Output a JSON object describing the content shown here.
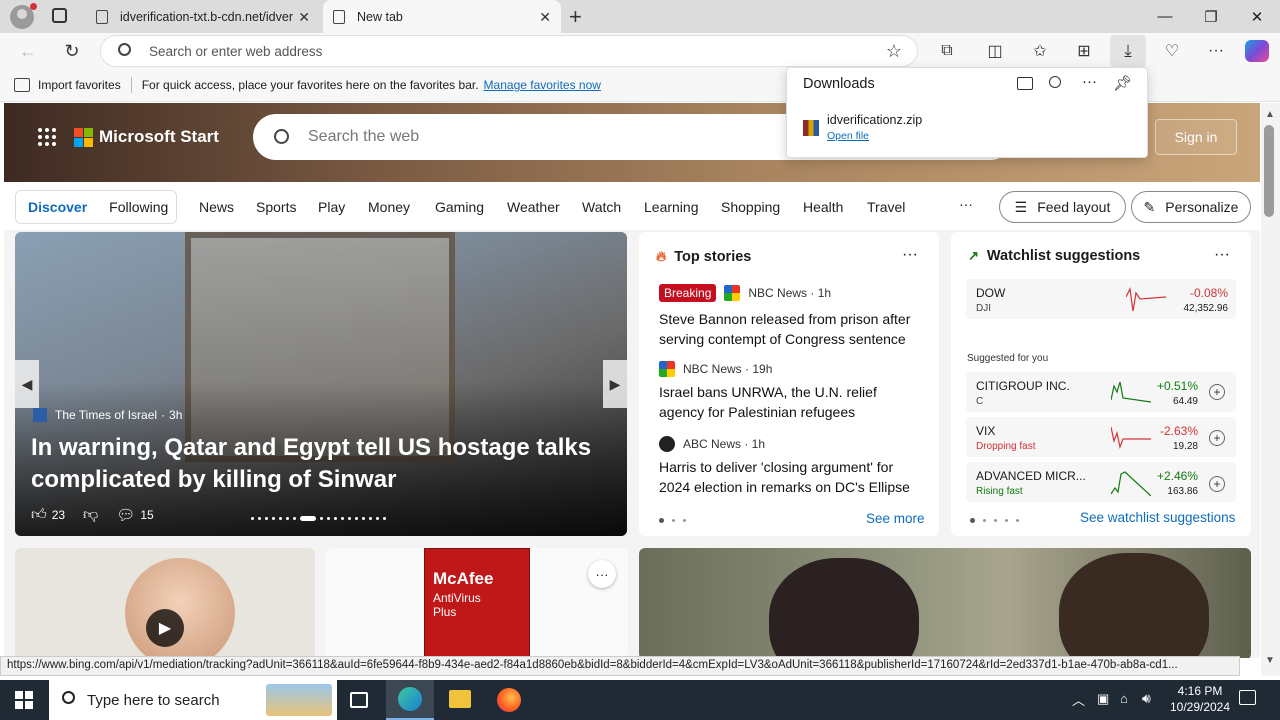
{
  "tabs": [
    {
      "label": "idverification-txt.b-cdn.net/idver"
    },
    {
      "label": "New tab"
    }
  ],
  "address_bar": {
    "placeholder": "Search or enter web address"
  },
  "favorites_bar": {
    "import_label": "Import favorites",
    "message": "For quick access, place your favorites here on the favorites bar.",
    "link": "Manage favorites now"
  },
  "downloads": {
    "title": "Downloads",
    "file_name": "idverificationz.zip",
    "open_label": "Open file"
  },
  "header": {
    "brand": "Microsoft Start",
    "search_placeholder": "Search the web",
    "sign_in": "Sign in"
  },
  "nav": {
    "discover": "Discover",
    "following": "Following",
    "items": [
      "News",
      "Sports",
      "Play",
      "Money",
      "Gaming",
      "Weather",
      "Watch",
      "Learning",
      "Shopping",
      "Health",
      "Travel"
    ],
    "more": "···",
    "feed_layout": "Feed layout",
    "personalize": "Personalize"
  },
  "hero_story": {
    "source": "The Times of Israel",
    "age": "3h",
    "title": "In warning, Qatar and Egypt tell US hostage talks complicated by killing of Sinwar",
    "likes": "23",
    "comments": "15"
  },
  "top_stories": {
    "header": "Top stories",
    "items": [
      {
        "badge": "Breaking",
        "source": "NBC News · 1h",
        "title": "Steve Bannon released from prison after serving contempt of Congress sentence"
      },
      {
        "source": "NBC News · 19h",
        "title": "Israel bans UNRWA, the U.N. relief agency for Palestinian refugees"
      },
      {
        "source": "ABC News · 1h",
        "title": "Harris to deliver 'closing argument' for 2024 election in remarks on DC's Ellipse"
      }
    ],
    "see_more": "See more"
  },
  "watchlist": {
    "header": "Watchlist suggestions",
    "dow": {
      "name": "DOW",
      "symbol": "DJI",
      "change": "-0.08%",
      "price": "42,352.96"
    },
    "suggested_label": "Suggested for you",
    "items": [
      {
        "name": "CITIGROUP INC.",
        "sub": "C",
        "change": "+0.51%",
        "price": "64.49"
      },
      {
        "name": "VIX",
        "sub": "Dropping fast",
        "change": "-2.63%",
        "price": "19.28"
      },
      {
        "name": "ADVANCED MICR...",
        "sub": "Rising fast",
        "change": "+2.46%",
        "price": "163.86"
      }
    ],
    "see_all": "See watchlist suggestions"
  },
  "promo": {
    "brand": "McAfee",
    "product": "AntiVirus Plus"
  },
  "status_url": "https://www.bing.com/api/v1/mediation/tracking?adUnit=366118&auId=6fe59644-f8b9-434e-aed2-f84a1d8860eb&bidId=8&bidderId=4&cmExpId=LV3&oAdUnit=366118&publisherId=17160724&rId=2ed337d1-b1ae-470b-ab8a-cd1...",
  "taskbar": {
    "search_placeholder": "Type here to search",
    "time": "4:16 PM",
    "date": "10/29/2024"
  },
  "colors": {
    "accent": "#0f6cbd",
    "negative": "#d13438",
    "positive": "#107c10",
    "breaking": "#c50f1f"
  }
}
